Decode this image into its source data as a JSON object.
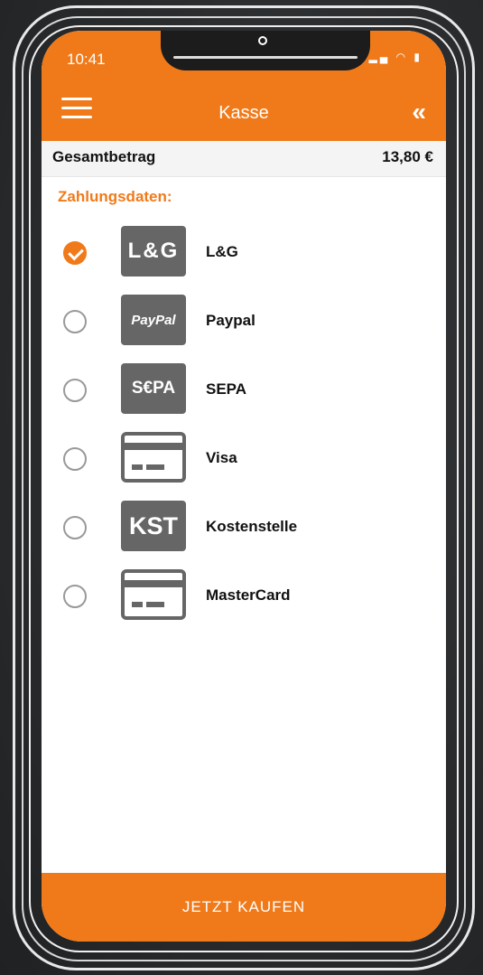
{
  "status": {
    "time": "10:41"
  },
  "header": {
    "title": "Kasse"
  },
  "total": {
    "label": "Gesamtbetrag",
    "value": "13,80 €"
  },
  "section": {
    "label": "Zahlungsdaten:"
  },
  "methods": [
    {
      "label": "L&G",
      "logo": "L&G",
      "selected": true
    },
    {
      "label": "Paypal",
      "logo": "PayPal",
      "selected": false
    },
    {
      "label": "SEPA",
      "logo": "S€PA",
      "selected": false
    },
    {
      "label": "Visa",
      "logo": "card-icon",
      "selected": false
    },
    {
      "label": "Kostenstelle",
      "logo": "KST",
      "selected": false
    },
    {
      "label": "MasterCard",
      "logo": "card-icon",
      "selected": false
    }
  ],
  "buy_button": {
    "label": "JETZT KAUFEN"
  },
  "colors": {
    "accent": "#f07a1a",
    "logo_gray": "#666666"
  }
}
